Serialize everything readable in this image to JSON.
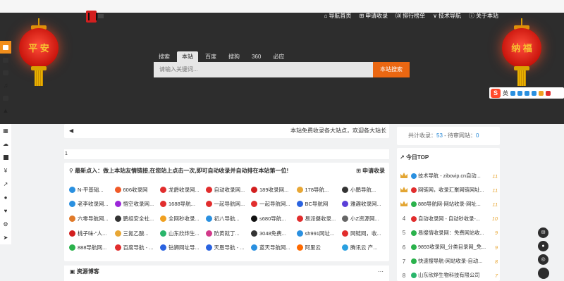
{
  "topnav": [
    "导航首页",
    "申请收录",
    "排行榜单",
    "技术导航",
    "关于本站"
  ],
  "lanterns": {
    "left": "平 安",
    "right": "纳 福"
  },
  "search": {
    "tabs": [
      "搜索",
      "本站",
      "百度",
      "搜狗",
      "360",
      "必应"
    ],
    "active": "本站",
    "placeholder": "请输入关键词...",
    "button": "本站搜索"
  },
  "sogou_bar": {
    "label": "英"
  },
  "notice": {
    "text": "本站免费收录各大站点，欢迎各大站长"
  },
  "strip": {
    "text": "1"
  },
  "links_panel": {
    "title": "最新点入：做上本站友情链接,在您站上点击一次,即可自动收录并自动排在本站第一位!",
    "request": "申请收录",
    "items": [
      {
        "name": "N-平基础...",
        "color": "#2a90e0"
      },
      {
        "name": "606收录网",
        "color": "#f05a28"
      },
      {
        "name": "龙爵收录网...",
        "color": "#e12d2d"
      },
      {
        "name": "自动收录网...",
        "color": "#e12d2d"
      },
      {
        "name": "189收录网...",
        "color": "#d21f1f"
      },
      {
        "name": "178导航...",
        "color": "#e8a735"
      },
      {
        "name": "小鹏导航...",
        "color": "#333"
      },
      {
        "name": "老李收录网...",
        "color": "#2a90e0"
      },
      {
        "name": "悟空收录网...",
        "color": "#9b27d9"
      },
      {
        "name": "1688导航...",
        "color": "#e12d2d"
      },
      {
        "name": "一起导航网...",
        "color": "#e12d2d"
      },
      {
        "name": "一起导航网...",
        "color": "#e12d2d"
      },
      {
        "name": "BC导航网",
        "color": "#2a63e0"
      },
      {
        "name": "雅趣收录网...",
        "color": "#5a3fd8"
      },
      {
        "name": "六零导航网...",
        "color": "#e07a2a"
      },
      {
        "name": "鹏组安全社...",
        "color": "#333"
      },
      {
        "name": "全网秒收录...",
        "color": "#f0a020"
      },
      {
        "name": "初八导航...",
        "color": "#2a90e0"
      },
      {
        "name": "s680导航...",
        "color": "#111"
      },
      {
        "name": "易派摄收录...",
        "color": "#e12d2d"
      },
      {
        "name": "小Z资源网...",
        "color": "#666"
      },
      {
        "name": "桃子味-\"人...",
        "color": "#d21f1f"
      },
      {
        "name": "三氮乙酸...",
        "color": "#e8a735"
      },
      {
        "name": "山东欣烨生...",
        "color": "#29b56b"
      },
      {
        "name": "防黄就丁...",
        "color": "#d23a8a"
      },
      {
        "name": "3048免费...",
        "color": "#333"
      },
      {
        "name": "sh991网址...",
        "color": "#2a90e0"
      },
      {
        "name": "网链网，收...",
        "color": "#e12d2d"
      },
      {
        "name": "888导航网...",
        "color": "#2bb24c"
      },
      {
        "name": "百度导航 - ...",
        "color": "#e12d2d"
      },
      {
        "name": "钻狮网址导...",
        "color": "#2a63e0"
      },
      {
        "name": "天恩导航 - ...",
        "color": "#2a63e0"
      },
      {
        "name": "蓝天导航网...",
        "color": "#2a90e0"
      },
      {
        "name": "阿里云",
        "color": "#ff6a00"
      },
      {
        "name": "腾讯云 产...",
        "color": "#2aa0e0"
      }
    ]
  },
  "blog": {
    "title": "资源博客",
    "more": "···"
  },
  "stats": {
    "label": "共计收录：",
    "count": "53",
    "pending_label": " - 待审网站：",
    "pending": "0"
  },
  "top": {
    "title": "今日TOP",
    "rows": [
      {
        "rank": "",
        "name": "技术导航 - zibovip.cn自动...",
        "num": "11",
        "color": "#2a90e0"
      },
      {
        "rank": "",
        "name": "网链网，收录汇聚网链网址...",
        "num": "11",
        "color": "#e12d2d"
      },
      {
        "rank": "",
        "name": "888导航网-网站收录-网址...",
        "num": "11",
        "color": "#2bb24c"
      },
      {
        "rank": "4",
        "name": "自动收录网 - 自动秒收录-...",
        "num": "10",
        "color": "#e12d2d"
      },
      {
        "rank": "5",
        "name": "易搜情收录网：免费网站收...",
        "num": "9",
        "color": "#2bb24c"
      },
      {
        "rank": "6",
        "name": "9893收录网_分类目录网_免...",
        "num": "9",
        "color": "#2bb24c"
      },
      {
        "rank": "7",
        "name": "快速搜导航-网站收录-自动...",
        "num": "8",
        "color": "#2bb24c"
      },
      {
        "rank": "8",
        "name": "山东欣烨生物科技有限公司",
        "num": "7",
        "color": "#29b56b"
      }
    ]
  }
}
